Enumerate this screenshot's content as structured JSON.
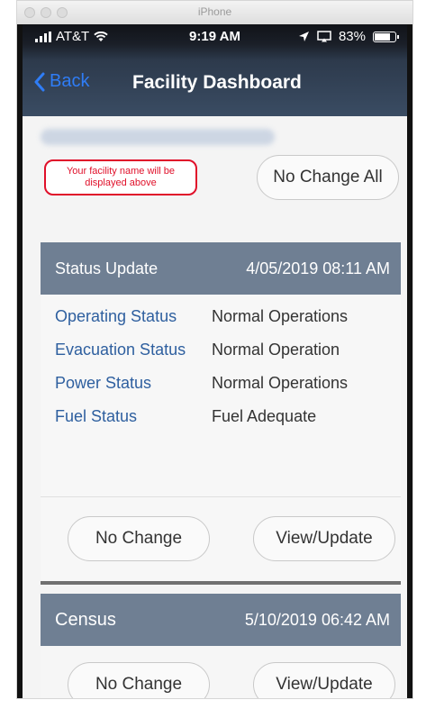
{
  "window": {
    "title": "iPhone"
  },
  "status_bar": {
    "carrier": "AT&T",
    "time": "9:19 AM",
    "battery": "83%",
    "battery_level": 0.83
  },
  "nav": {
    "back_label": "Back",
    "title": "Facility Dashboard"
  },
  "hint": {
    "text": "Your facility name will be displayed above"
  },
  "top_actions": {
    "no_change_all_label": "No Change All"
  },
  "status_card": {
    "title": "Status Update",
    "date": "4/05/2019 08:11 AM",
    "rows": [
      {
        "label": "Operating Status",
        "value": "Normal Operations"
      },
      {
        "label": "Evacuation Status",
        "value": "Normal Operation"
      },
      {
        "label": "Power Status",
        "value": "Normal Operations"
      },
      {
        "label": "Fuel Status",
        "value": "Fuel Adequate"
      }
    ],
    "no_change_label": "No Change",
    "view_update_label": "View/Update"
  },
  "census_card": {
    "title": "Census",
    "date": "5/10/2019 06:42 AM",
    "no_change_label": "No Change",
    "view_update_label": "View/Update"
  },
  "colors": {
    "accent_blue": "#2f7df6",
    "label_blue": "#2e5f9f",
    "header_gray": "#6f7f93",
    "hint_red": "#e0102a"
  }
}
